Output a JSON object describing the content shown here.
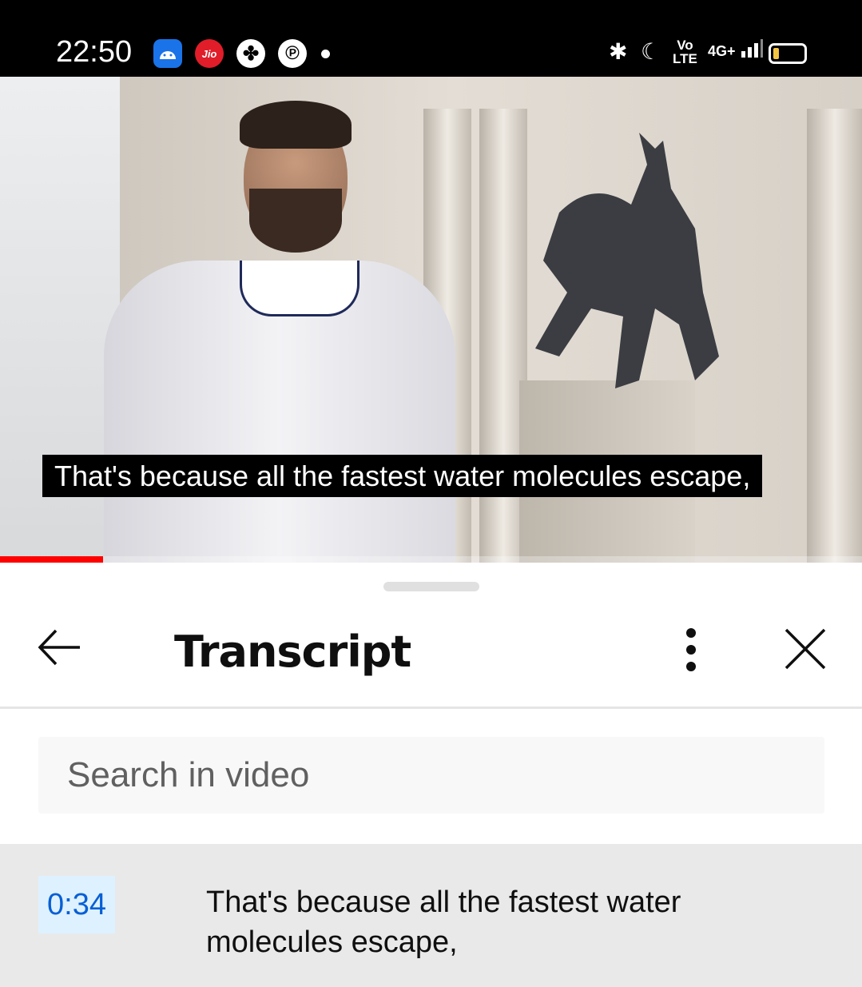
{
  "status_bar": {
    "time": "22:50",
    "notification_icons": [
      "android-icon",
      "jio-icon",
      "pinwheel-icon",
      "pinterest-icon",
      "dot-icon"
    ],
    "jio_label": "Jio",
    "system_icons": [
      "bluetooth-icon",
      "do-not-disturb-icon",
      "volte-icon",
      "signal-4g-icon",
      "battery-icon"
    ],
    "volte_label_top": "Vo",
    "volte_label_bottom": "LTE",
    "network_label": "4G+"
  },
  "video": {
    "caption": "That's because all the fastest water molecules escape,",
    "progress_fraction": 0.12,
    "progress_color": "#ff0000"
  },
  "transcript_panel": {
    "title": "Transcript",
    "search_placeholder": "Search in video",
    "segments": [
      {
        "timestamp": "0:34",
        "text": "That's because all the fastest water molecules escape,"
      }
    ]
  },
  "colors": {
    "timestamp_text": "#065fd4",
    "timestamp_bg": "#def1ff",
    "active_segment_bg": "#e9e9e9"
  }
}
